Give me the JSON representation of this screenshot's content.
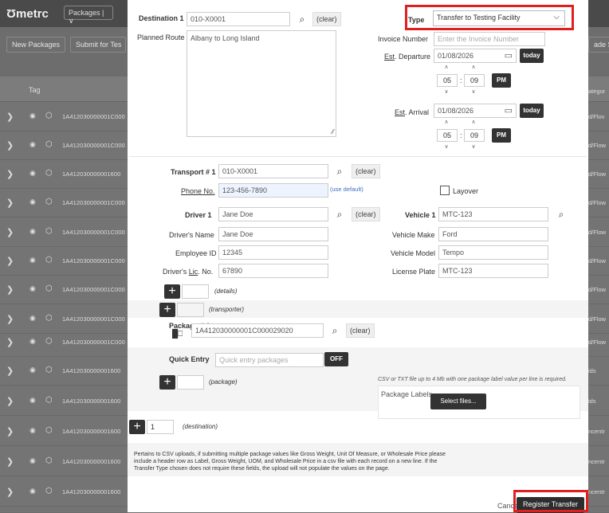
{
  "background": {
    "logo": "Ʊmetrc",
    "packages_menu": "Packages | ∨",
    "new_packages": "New Packages",
    "submit": "Submit for Tes",
    "tag_header": "Tag",
    "right_header": "ade S",
    "right_header2": "ategor",
    "rows": [
      {
        "tag": "1A412030000001C000",
        "right": "d/Flov"
      },
      {
        "tag": "1A412030000001C000",
        "right": "d/Flow"
      },
      {
        "tag": "1A412030000001600",
        "right": "d/Flow"
      },
      {
        "tag": "1A412030000001C000",
        "right": "d/Flow"
      },
      {
        "tag": "1A412030000001C000",
        "right": "d/Flow"
      },
      {
        "tag": "1A412030000001C000",
        "right": "d/Flow"
      },
      {
        "tag": "1A412030000001C000",
        "right": "d/Flow"
      },
      {
        "tag": "1A412030000001C000",
        "right": "d/Flow"
      },
      {
        "tag": "1A412030000001C000",
        "right": "d/Flow"
      },
      {
        "tag": "1A412030000001600",
        "right": "ids"
      },
      {
        "tag": "1A412030000001600",
        "right": "ids"
      },
      {
        "tag": "1A412030000001600",
        "right": "ncentr"
      },
      {
        "tag": "1A412030000001600",
        "right": "ncentr"
      },
      {
        "tag": "1A412030000001600",
        "right": "ncentr"
      }
    ]
  },
  "destination": {
    "label": "Destination 1",
    "value": "010-X0001",
    "clear": "(clear)",
    "planned_route_label": "Planned Route",
    "planned_route": "Albany to Long Island"
  },
  "type": {
    "label": "Type",
    "value": "Transfer to Testing Facility"
  },
  "invoice": {
    "label": "Invoice Number",
    "placeholder": "Enter the Invoice Number"
  },
  "departure": {
    "label_prefix": "Est",
    "label_rest": ". Departure",
    "date": "01/08/2026",
    "today": "today",
    "hour": "05",
    "minute": "09",
    "ampm": "PM"
  },
  "arrival": {
    "label_prefix": "Est",
    "label_rest": ". Arrival",
    "date": "01/08/2026",
    "today": "today",
    "hour": "05",
    "minute": "09",
    "ampm": "PM"
  },
  "transport": {
    "label": "Transport # 1",
    "value": "010-X0001",
    "clear": "(clear)",
    "phone_label": "Phone No.",
    "phone": "123-456-7890",
    "use_default": "(use default)",
    "layover": "Layover"
  },
  "driver": {
    "label": "Driver 1",
    "value": "Jane Doe",
    "clear": "(clear)",
    "name_label": "Driver's Name",
    "name": "Jane Doe",
    "employee_label": "Employee ID",
    "employee": "12345",
    "lic_label_a": "Driver's ",
    "lic_label_b": "Lic",
    "lic_label_c": ". No.",
    "lic": "67890"
  },
  "vehicle": {
    "label": "Vehicle 1",
    "value": "MTC-123",
    "make_label": "Vehicle Make",
    "make": "Ford",
    "model_label": "Vehicle Model",
    "model": "Tempo",
    "plate_label": "License Plate",
    "plate": "MTC-123"
  },
  "details": "(details)",
  "transporter": "(transporter)",
  "package": {
    "label": "Package # 1",
    "value": "1A412030000001C000029020",
    "clear": "(clear)",
    "quick_entry_label": "Quick Entry",
    "quick_entry_placeholder": "Quick entry packages",
    "off": "OFF",
    "package_link": "(package)",
    "csv_note": "CSV or TXT file up to 4 Mb with one package label value per line is required.",
    "labels_label": "Package Labels",
    "select_files": "Select files..."
  },
  "destination_add": {
    "count": "1",
    "label": "(destination)"
  },
  "note": "Pertains to CSV uploads, if submitting multiple package values like Gross Weight, Unit Of Measure, or Wholesale Price please include a header row as Label, Gross Weight, UOM, and Wholesale Price in a csv file with each record on a new line. If the Transfer Type chosen does not require these fields, the upload will not populate the values on the page.",
  "footer": {
    "cancel": "Cancel",
    "register": "Register Transfer"
  },
  "colors": {
    "highlight": "#e02020",
    "dark_button": "#333333"
  }
}
